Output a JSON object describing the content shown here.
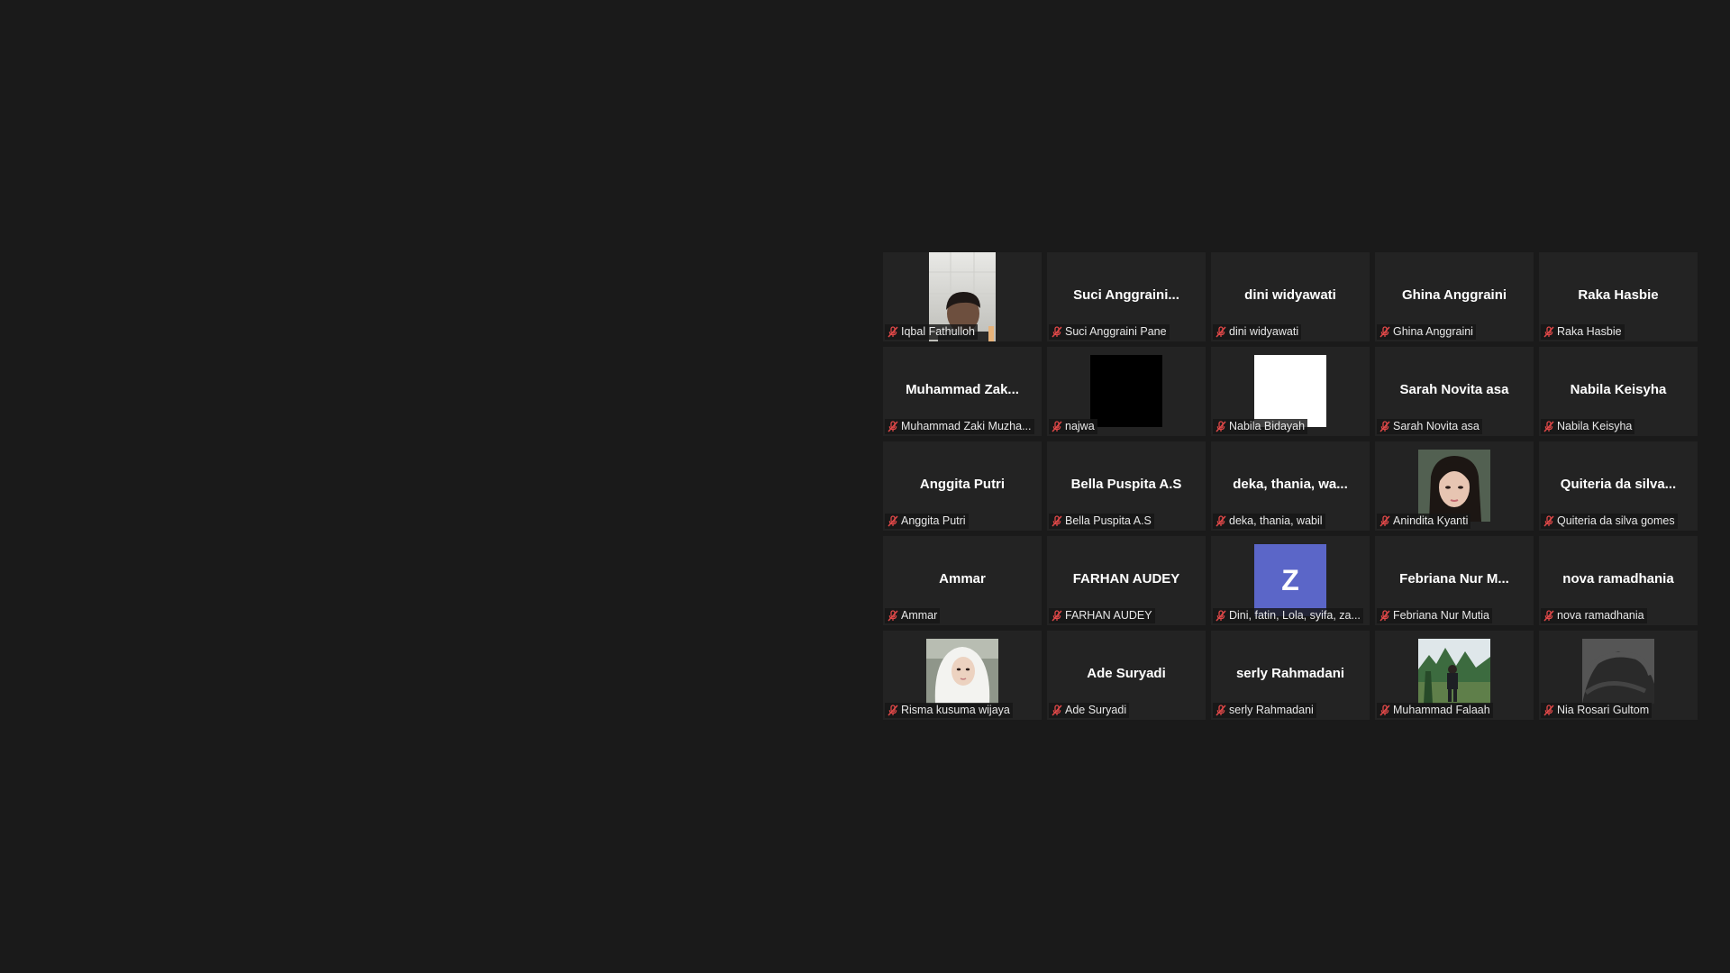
{
  "meeting": {
    "participants": [
      {
        "tile_label": "",
        "name": "Iqbal Fathulloh",
        "avatar": "video-face-dark",
        "muted": true
      },
      {
        "tile_label": "Suci  Anggraini...",
        "name": "Suci Anggraini Pane",
        "avatar": "none",
        "muted": true
      },
      {
        "tile_label": "dini widyawati",
        "name": "dini widyawati",
        "avatar": "none",
        "muted": true
      },
      {
        "tile_label": "Ghina Anggraini",
        "name": "Ghina Anggraini",
        "avatar": "none",
        "muted": true
      },
      {
        "tile_label": "Raka Hasbie",
        "name": "Raka Hasbie",
        "avatar": "none",
        "muted": true
      },
      {
        "tile_label": "Muhammad  Zak...",
        "name": "Muhammad Zaki Muzha...",
        "avatar": "none",
        "muted": true
      },
      {
        "tile_label": "",
        "name": "najwa",
        "avatar": "black-square",
        "muted": true
      },
      {
        "tile_label": "",
        "name": "Nabila Bidayah",
        "avatar": "white-square",
        "muted": true
      },
      {
        "tile_label": "Sarah Novita asa",
        "name": "Sarah Novita asa",
        "avatar": "none",
        "muted": true
      },
      {
        "tile_label": "Nabila Keisyha",
        "name": "Nabila Keisyha",
        "avatar": "none",
        "muted": true
      },
      {
        "tile_label": "Anggita Putri",
        "name": "Anggita Putri",
        "avatar": "none",
        "muted": true
      },
      {
        "tile_label": "Bella Puspita A.S",
        "name": "Bella Puspita A.S",
        "avatar": "none",
        "muted": true
      },
      {
        "tile_label": "deka,  thania,  wa...",
        "name": "deka, thania, wabil",
        "avatar": "none",
        "muted": true
      },
      {
        "tile_label": "",
        "name": "Anindita Kyanti",
        "avatar": "photo-portrait",
        "muted": true
      },
      {
        "tile_label": "Quiteria  da  silva...",
        "name": "Quiteria da silva gomes",
        "avatar": "none",
        "muted": true
      },
      {
        "tile_label": "Ammar",
        "name": "Ammar",
        "avatar": "none",
        "muted": true
      },
      {
        "tile_label": "FARHAN AUDEY",
        "name": "FARHAN AUDEY",
        "avatar": "none",
        "muted": true
      },
      {
        "tile_label": "",
        "name": "Dini, fatin, Lola, syifa, za...",
        "avatar": "letter",
        "letter": "Z",
        "muted": true
      },
      {
        "tile_label": "Febriana  Nur  M...",
        "name": "Febriana Nur Mutia",
        "avatar": "none",
        "muted": true
      },
      {
        "tile_label": "nova ramadhania",
        "name": "nova ramadhania",
        "avatar": "none",
        "muted": true
      },
      {
        "tile_label": "",
        "name": "Risma kusuma wijaya",
        "avatar": "photo-hijab",
        "muted": true
      },
      {
        "tile_label": "Ade Suryadi",
        "name": "Ade Suryadi",
        "avatar": "none",
        "muted": true
      },
      {
        "tile_label": "serly Rahmadani",
        "name": "serly Rahmadani",
        "avatar": "none",
        "muted": true
      },
      {
        "tile_label": "",
        "name": "Muhammad Falaah",
        "avatar": "photo-outdoor",
        "muted": true
      },
      {
        "tile_label": "",
        "name": "Nia Rosari Gultom",
        "avatar": "photo-gray",
        "muted": true
      }
    ]
  },
  "colors": {
    "background": "#1a1a1a",
    "tile": "#232323",
    "letter_avatar": "#5b66c8",
    "muted_mic": "#e04848"
  },
  "icons": {
    "mic": "mic-muted-icon"
  }
}
